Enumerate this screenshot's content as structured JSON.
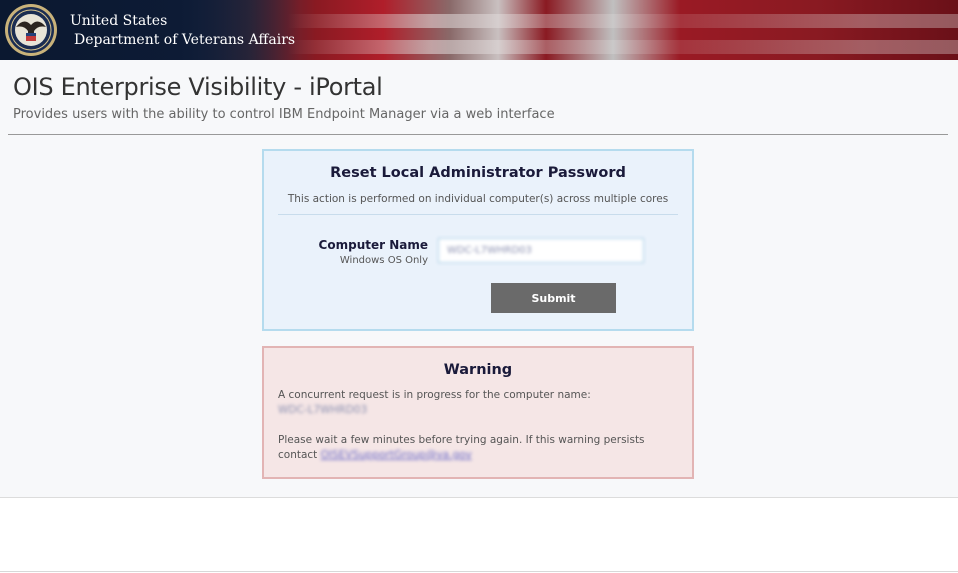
{
  "header": {
    "agency_line1": "United States",
    "agency_line2": "Department of Veterans Affairs",
    "seal_icon": "va-seal-icon"
  },
  "page": {
    "title": "OIS Enterprise Visibility - iPortal",
    "subtitle": "Provides users with the ability to control IBM Endpoint Manager via a web interface"
  },
  "reset_panel": {
    "title": "Reset Local Administrator Password",
    "description": "This action is performed on individual computer(s) across multiple cores",
    "computer_name_label": "Computer Name",
    "computer_name_hint": "Windows OS Only",
    "computer_name_value": "WDC-L7WHRD03",
    "submit_label": "Submit"
  },
  "warning_panel": {
    "title": "Warning",
    "message": "A concurrent request is in progress for the computer name:",
    "computer_name": "WDC-L7WHRD03",
    "wait_message": "Please wait a few minutes before trying again. If this warning persists",
    "contact_prefix": "contact",
    "contact_email": "OISEVSupportGroup@va.gov"
  },
  "colors": {
    "panel_bg": "#eaf2fb",
    "panel_border": "#b5dbee",
    "warning_bg": "#f5e6e6",
    "warning_border": "#e2b4b4",
    "button_bg": "#6a6a6a"
  }
}
